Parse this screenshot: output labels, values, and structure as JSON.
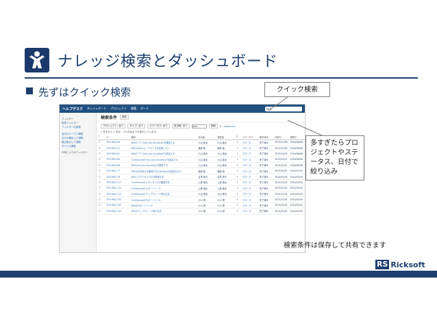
{
  "slide": {
    "title": "ナレッジ検索とダッシュボード",
    "bullet": "先ずはクイック検索",
    "callout_quick": "クイック検索",
    "callout_many": "多すぎたらプロジェクトやステータス、日付で絞り込み",
    "callout_note": "検索条件は保存して共有できます"
  },
  "colors": {
    "brand": "#1d3e6e",
    "jira_bar": "#205081",
    "link": "#3572b0"
  },
  "jira": {
    "brand": "ヘルプデスク",
    "nav": [
      "ダッシュボード",
      "プロジェクト",
      "課題",
      "ボード"
    ],
    "search_placeholder": "検索",
    "sidebar": {
      "head1": "フィルター",
      "items1": [
        "新規フィルター",
        "フィルターの検索"
      ],
      "items2": [
        "自分のオープン課題",
        "自分が報告した課題",
        "最近表示した課題",
        "すべての課題"
      ],
      "head2": "お気に入りのフィルター"
    },
    "main_title": "検索条件",
    "save_button": "保存",
    "filters": [
      "プロジェクト: 全て",
      "タイプ: 全て",
      "ステータス: 全て",
      "担当者: 全て"
    ],
    "search_value": "java",
    "more_label": "詳細",
    "advanced_label": "Advanced",
    "count": "1 件中から 1 件目 -- 20 件目までを表示しています。",
    "columns": [
      "T",
      "キー",
      "要約",
      "担当者",
      "報告者",
      "P",
      "ステータス",
      "解決状況",
      "作成日",
      "更新日"
    ],
    "rows": [
      {
        "key": "TECHFAQ-89",
        "sum": "Webアプリ\"Just you encoding\"を確認する",
        "as": "小山 慶太",
        "rp": "小山 慶太",
        "st": "クローズ",
        "res": "完了済み",
        "cr": "2013/11/08",
        "up": "2016/06/06"
      },
      {
        "key": "TECHFAQ-91",
        "sum": "JIRA のJava ヒープサイズを変更したい",
        "as": "篠原 裕",
        "rp": "篠原 裕",
        "st": "クローズ",
        "res": "完了済み",
        "cr": "2013/10/09",
        "up": "2016/06/06"
      },
      {
        "key": "TECHFAQ-81",
        "sum": "Webアプリ\"Just you encoding\"を設定する",
        "as": "小山 慶太",
        "rp": "小山 慶太",
        "st": "クローズ",
        "res": "完了済み",
        "cr": "2013/10/01",
        "up": "2016/06/06"
      },
      {
        "key": "TECHFAQ-80",
        "sum": "Confluenceの\"Just you encoding\"を設定する",
        "as": "小山 慶太",
        "rp": "小山 慶太",
        "st": "クローズ",
        "res": "完了済み",
        "cr": "2013/10/01",
        "up": "2016/06/06"
      },
      {
        "key": "TECHFAQ-86",
        "sum": "JIRA\"Just you encoding\"を確認する",
        "as": "小山 慶太",
        "rp": "小山 慶太",
        "st": "クローズ",
        "res": "完了済み",
        "cr": "2013/10/01",
        "up": "2016/06/06"
      },
      {
        "key": "TECHFAQ-77",
        "sum": "PDFの文字化けを解消するためのJavaの設定を行う",
        "as": "篠原 裕",
        "rp": "篠原 裕",
        "st": "クローズ",
        "res": "完了済み",
        "cr": "2013/10/01",
        "up": "2014/11/20"
      },
      {
        "key": "TECHFAQ-76",
        "sum": "JIRAとのアクセスログの取得方法",
        "as": "吉澤 慶行",
        "rp": "吉澤 慶行",
        "st": "クローズ",
        "res": "完了済み",
        "cr": "2014/03/16",
        "up": "2014/03/16"
      },
      {
        "key": "TECHFAQ-117",
        "sum": "Confluenceのメモリサイズの確認方法",
        "as": "上原 健太",
        "rp": "上原 健太",
        "st": "クローズ",
        "res": "完了済み",
        "cr": "2013/12/24",
        "up": "2014/03/20"
      },
      {
        "key": "TECHFAQ-114",
        "sum": "Confluenceのサポートツール",
        "as": "上原 健太",
        "rp": "上原 健太",
        "st": "クローズ",
        "res": "完了済み",
        "cr": "2013/12/24",
        "up": "2014/03/20"
      },
      {
        "key": "TECHFAQ-112",
        "sum": "Confluenceのアップグレード時の注意",
        "as": "小山 慶太",
        "rp": "小山 慶太",
        "st": "クローズ",
        "res": "完了済み",
        "cr": "2013/12/24",
        "up": "2014/03/20"
      },
      {
        "key": "TECHFAQ-102",
        "sum": "Confluenceのサポートツール",
        "as": "小川 啓",
        "rp": "小川 啓",
        "st": "クローズ",
        "res": "完了済み",
        "cr": "2013/12/24",
        "up": "2014/03/20"
      },
      {
        "key": "TECHFAQ-103",
        "sum": "JIRAのサポートツール",
        "as": "小川 啓",
        "rp": "小川 啓",
        "st": "クローズ",
        "res": "完了済み",
        "cr": "2013/12/24",
        "up": "2014/03/20"
      },
      {
        "key": "TECHFAQ-104",
        "sum": "JIRAのアップグレード時の注意",
        "as": "小川 啓",
        "rp": "小川 啓",
        "st": "クローズ",
        "res": "完了済み",
        "cr": "2013/12/24",
        "up": "2014/03/20"
      }
    ]
  },
  "footer": {
    "logo_mark": "RS",
    "logo_word": "Ricksoft"
  }
}
